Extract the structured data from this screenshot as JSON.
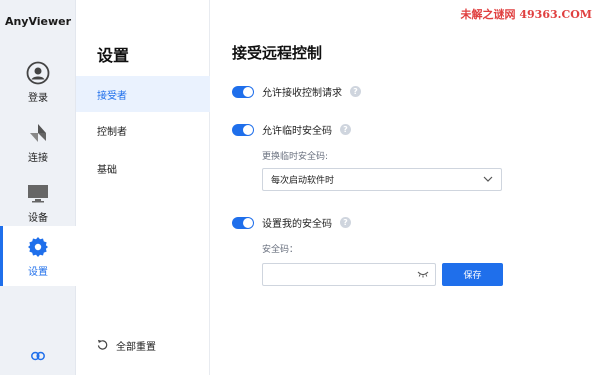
{
  "app": {
    "title": "AnyViewer"
  },
  "rail": {
    "items": [
      {
        "label": "登录",
        "icon": "user-icon"
      },
      {
        "label": "连接",
        "icon": "connect-icon"
      },
      {
        "label": "设备",
        "icon": "monitor-icon"
      },
      {
        "label": "设置",
        "icon": "gear-icon",
        "active": true
      }
    ],
    "link_icon": "link-icon"
  },
  "subnav": {
    "title": "设置",
    "items": [
      {
        "label": "接受者",
        "active": true
      },
      {
        "label": "控制者"
      },
      {
        "label": "基础"
      }
    ],
    "reset_label": "全部重置"
  },
  "main": {
    "title": "接受远程控制",
    "option1": {
      "label": "允许接收控制请求",
      "enabled": true
    },
    "option2": {
      "label": "允许临时安全码",
      "enabled": true
    },
    "change_label": "更换临时安全码:",
    "change_select_value": "每次启动软件时",
    "option3": {
      "label": "设置我的安全码",
      "enabled": true
    },
    "security_code_label": "安全码：",
    "security_code_value": "",
    "save_label": "保存"
  },
  "watermark": "未解之谜网 49363.COM",
  "colors": {
    "accent": "#1f6feb",
    "rail_bg": "#eef1f6",
    "active_bg": "#eaf2fe"
  }
}
